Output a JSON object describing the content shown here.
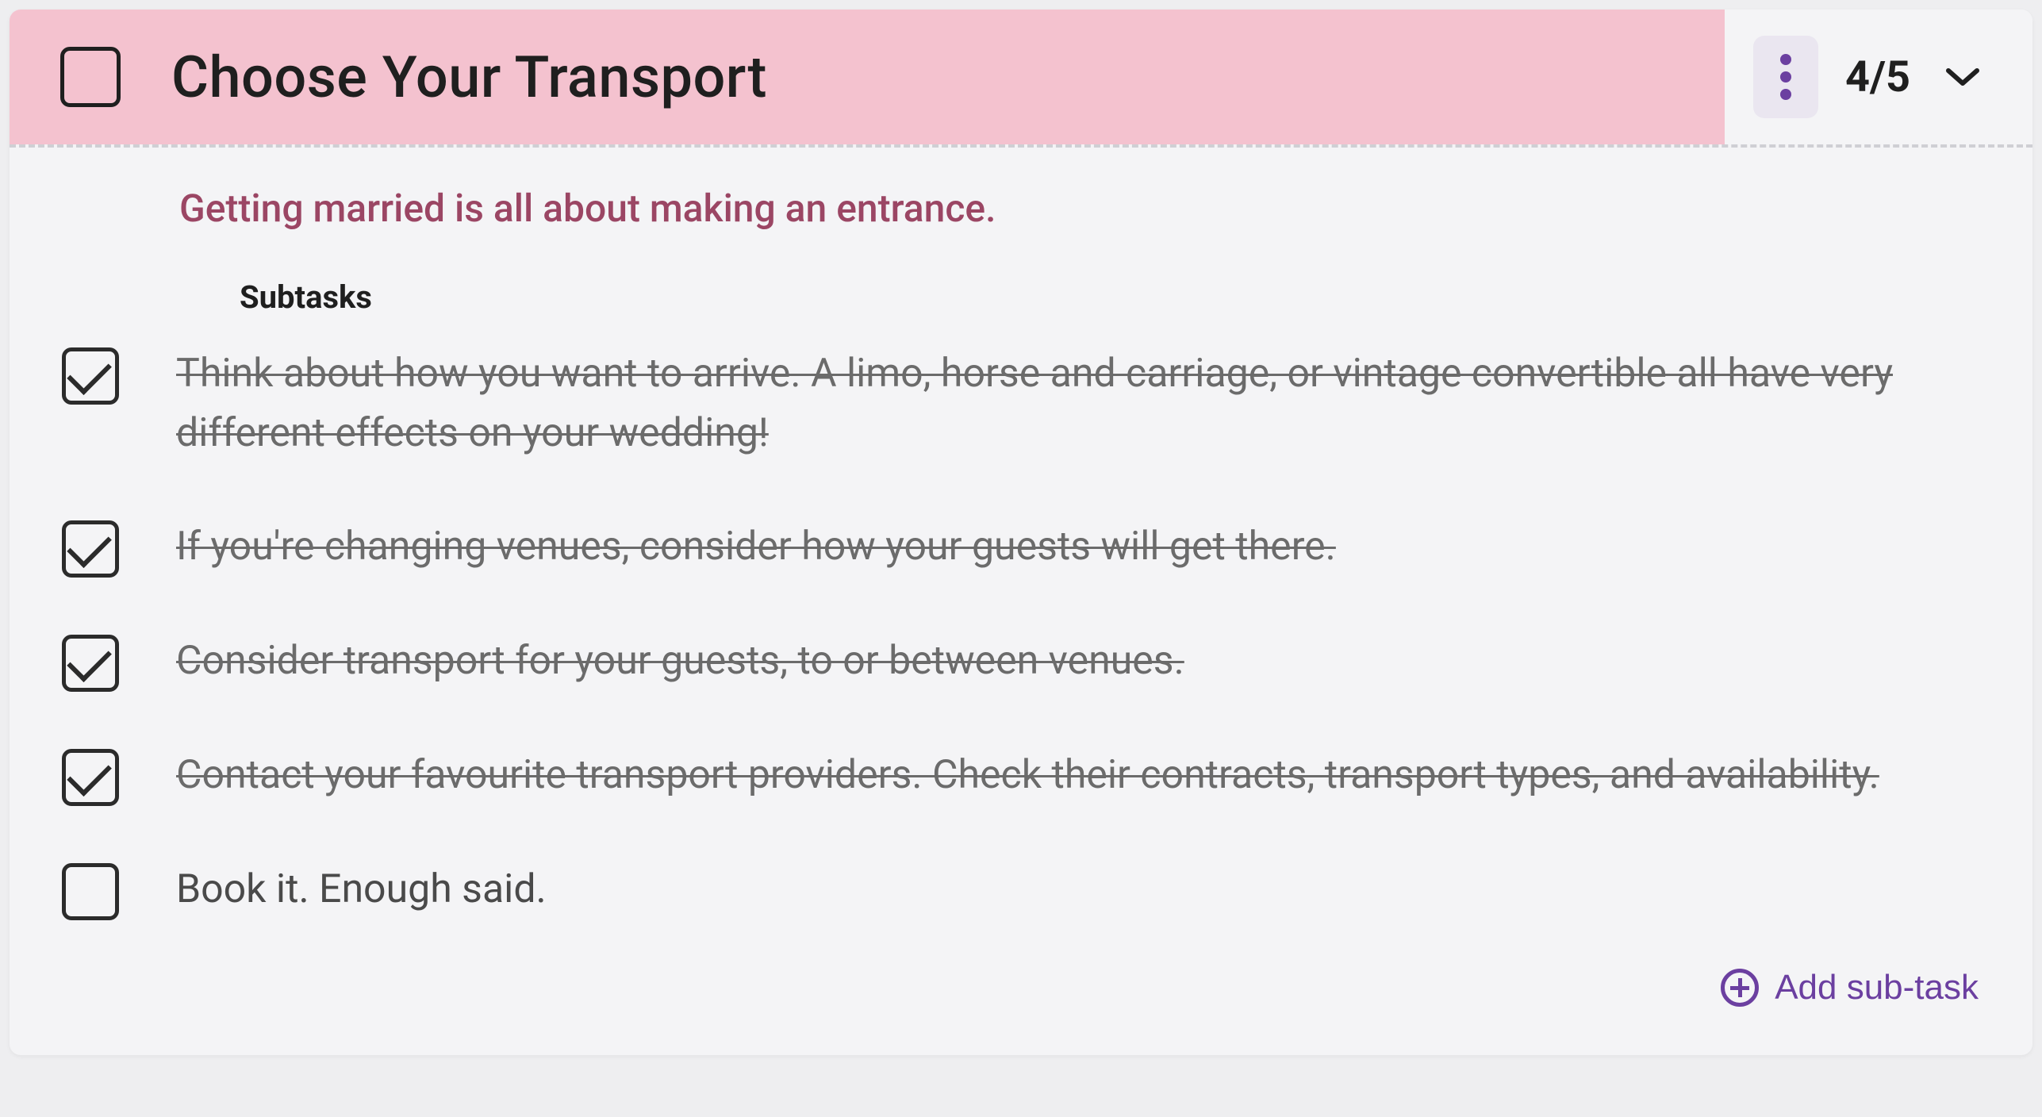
{
  "task": {
    "title": "Choose Your Transport",
    "checked": false,
    "counter": "4/5",
    "description": "Getting married is all about making an entrance."
  },
  "subtasks_label": "Subtasks",
  "subtasks": [
    {
      "text": "Think about how you want to arrive. A limo, horse and carriage, or vintage convertible all have very different effects on your wedding!",
      "done": true
    },
    {
      "text": "If you're changing venues, consider how your guests will get there.",
      "done": true
    },
    {
      "text": "Consider transport for your guests, to or between venues.",
      "done": true
    },
    {
      "text": "Contact your favourite transport providers. Check their contracts, transport types, and availability.",
      "done": true
    },
    {
      "text": "Book it. Enough said.",
      "done": false
    }
  ],
  "add_subtask_label": "Add sub-task"
}
